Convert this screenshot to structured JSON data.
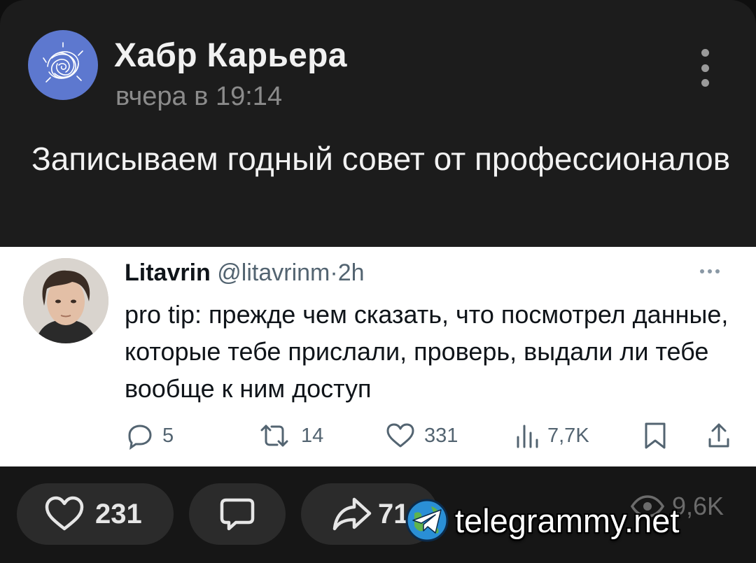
{
  "post": {
    "channel_name": "Хабр Карьера",
    "timestamp": "вчера в 19:14",
    "text": "Записываем годный совет от профессионалов"
  },
  "tweet": {
    "name": "Litavrin",
    "handle": "@litavrinm",
    "separator": "·",
    "time": "2h",
    "text": "pro tip: прежде чем сказать, что посмотрел данные, которые тебе прислали, проверь, выдали ли тебе вообще к ним доступ",
    "replies": "5",
    "retweets": "14",
    "likes": "331",
    "views": "7,7K"
  },
  "bottom_bar": {
    "likes": "231",
    "shares": "71",
    "views": "9,6K"
  },
  "watermark": {
    "text": "telegrammy.net"
  },
  "icons": {
    "more": "kebab-icon",
    "like": "heart-icon",
    "comment": "comment-icon",
    "share": "share-arrow-icon",
    "views": "eye-icon"
  },
  "colors": {
    "card_bg": "#1c1c1c",
    "avatar_bg": "#5d78cf",
    "tweet_bg": "#ffffff",
    "muted": "#536471"
  }
}
